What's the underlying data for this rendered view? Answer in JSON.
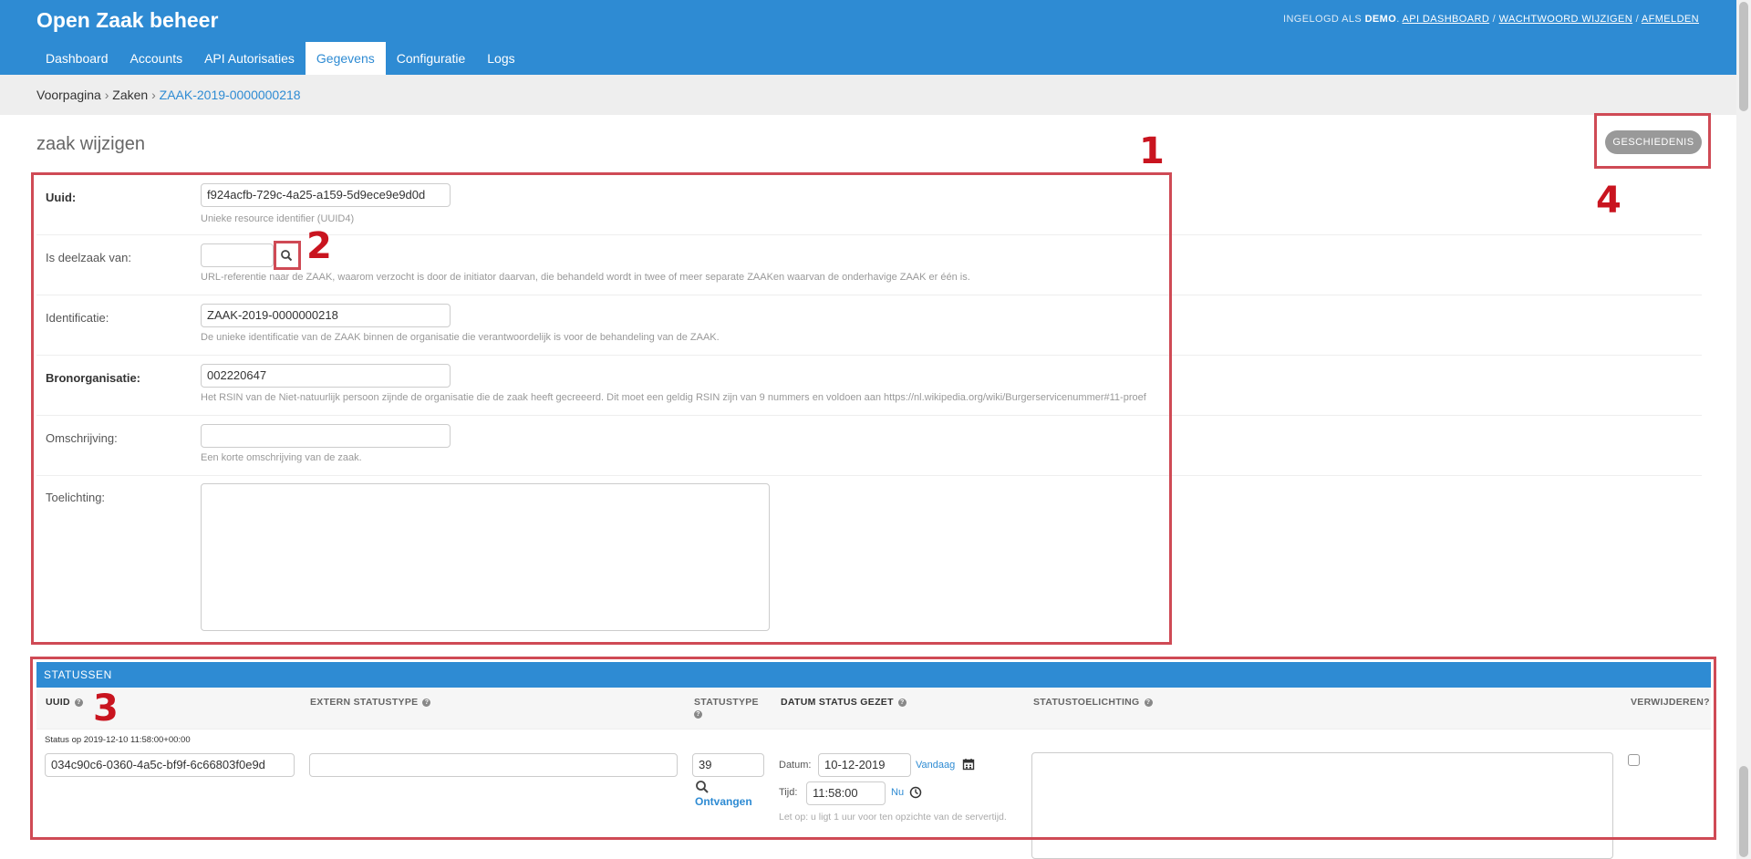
{
  "header": {
    "brand": "Open Zaak beheer",
    "user_tools": {
      "logged_in_as": "Ingelogd als",
      "user": "demo",
      "api_dashboard": "API dashboard",
      "change_password": "Wachtwoord wijzigen",
      "logout": "Afmelden",
      "sep": "/"
    }
  },
  "nav": {
    "items": [
      "Dashboard",
      "Accounts",
      "API Autorisaties",
      "Gegevens",
      "Configuratie",
      "Logs"
    ],
    "active": "Gegevens"
  },
  "breadcrumbs": {
    "home": "Voorpagina",
    "section": "Zaken",
    "current": "ZAAK-2019-0000000218",
    "sep": "›"
  },
  "page": {
    "title": "zaak wijzigen",
    "history_button": "Geschiedenis"
  },
  "annotations": {
    "n1": "1",
    "n2": "2",
    "n3": "3",
    "n4": "4"
  },
  "form": {
    "uuid": {
      "label": "Uuid:",
      "value": "f924acfb-729c-4a25-a159-5d9ece9e9d0d",
      "help": "Unieke resource identifier (UUID4)"
    },
    "deelzaak": {
      "label": "Is deelzaak van:",
      "value": "",
      "help": "URL-referentie naar de ZAAK, waarom verzocht is door de initiator daarvan, die behandeld wordt in twee of meer separate ZAAKen waarvan de onderhavige ZAAK er één is."
    },
    "identificatie": {
      "label": "Identificatie:",
      "value": "ZAAK-2019-0000000218",
      "help": "De unieke identificatie van de ZAAK binnen de organisatie die verantwoordelijk is voor de behandeling van de ZAAK."
    },
    "bronorganisatie": {
      "label": "Bronorganisatie:",
      "value": "002220647",
      "help": "Het RSIN van de Niet-natuurlijk persoon zijnde de organisatie die de zaak heeft gecreeerd. Dit moet een geldig RSIN zijn van 9 nummers en voldoen aan https://nl.wikipedia.org/wiki/Burgerservicenummer#11-proef"
    },
    "omschrijving": {
      "label": "Omschrijving:",
      "value": "",
      "help": "Een korte omschrijving van de zaak."
    },
    "toelichting": {
      "label": "Toelichting:",
      "value": ""
    }
  },
  "statussen": {
    "title": "Statussen",
    "columns": {
      "uuid": "Uuid",
      "extern": "Extern statustype",
      "statustype": "Statustype",
      "datum": "Datum status gezet",
      "toelichting": "Statustoelichting",
      "verwijderen": "Verwijderen?"
    },
    "row": {
      "caption": "Status op 2019-12-10 11:58:00+00:00",
      "uuid": "034c90c6-0360-4a5c-bf9f-6c66803f0e9d",
      "extern": "",
      "statustype": "39",
      "statustype_link": "Ontvangen",
      "datum_label": "Datum:",
      "datum": "10-12-2019",
      "today": "Vandaag",
      "tijd_label": "Tijd:",
      "tijd": "11:58:00",
      "now": "Nu",
      "tz_note": "Let op: u ligt 1 uur voor ten opzichte van de servertijd.",
      "toelichting": ""
    }
  },
  "colors": {
    "primary": "#2e8bd3",
    "highlight": "#cf4a55",
    "annotation": "#c9141f"
  }
}
